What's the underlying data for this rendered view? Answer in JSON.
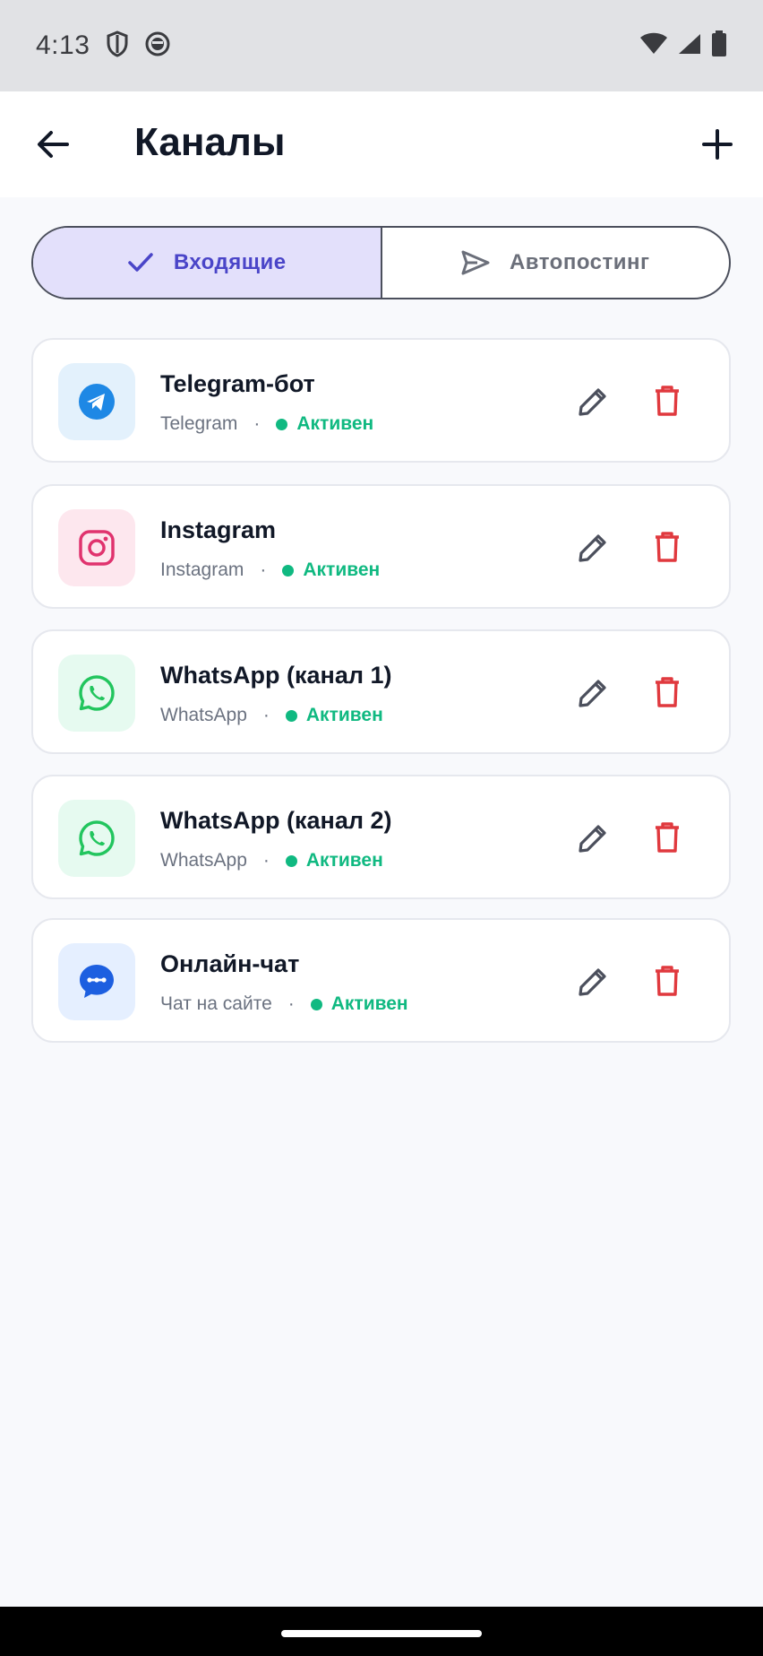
{
  "status_bar": {
    "time": "4:13"
  },
  "app_bar": {
    "title": "Каналы"
  },
  "tabs": [
    {
      "label": "Входящие",
      "active": true
    },
    {
      "label": "Автопостинг",
      "active": false
    }
  ],
  "channels": [
    {
      "title": "Telegram-бот",
      "type": "Telegram",
      "separator": "·",
      "status": "Активен",
      "icon": "telegram-icon",
      "icon_bg": "#e3f1fc",
      "icon_color": "#1e88e5"
    },
    {
      "title": "Instagram",
      "type": "Instagram",
      "separator": "·",
      "status": "Активен",
      "icon": "instagram-icon",
      "icon_bg": "#fde7ee",
      "icon_color": "#e0336e"
    },
    {
      "title": "WhatsApp (канал 1)",
      "type": "WhatsApp",
      "separator": "·",
      "status": "Активен",
      "icon": "whatsapp-icon",
      "icon_bg": "#e6faf0",
      "icon_color": "#22c55e"
    },
    {
      "title": "WhatsApp (канал 2)",
      "type": "WhatsApp",
      "separator": "·",
      "status": "Активен",
      "icon": "whatsapp-icon",
      "icon_bg": "#e6faf0",
      "icon_color": "#22c55e"
    },
    {
      "title": "Онлайн-чат",
      "type": "Чат на сайте",
      "separator": "·",
      "status": "Активен",
      "icon": "chat-icon",
      "icon_bg": "#e5efff",
      "icon_color": "#1d5fe0"
    }
  ],
  "colors": {
    "accent": "#4a45c8",
    "active_tab_bg": "#e3e0fb",
    "status_active": "#10b981",
    "delete": "#e0393e",
    "edit": "#4b4f5c"
  }
}
